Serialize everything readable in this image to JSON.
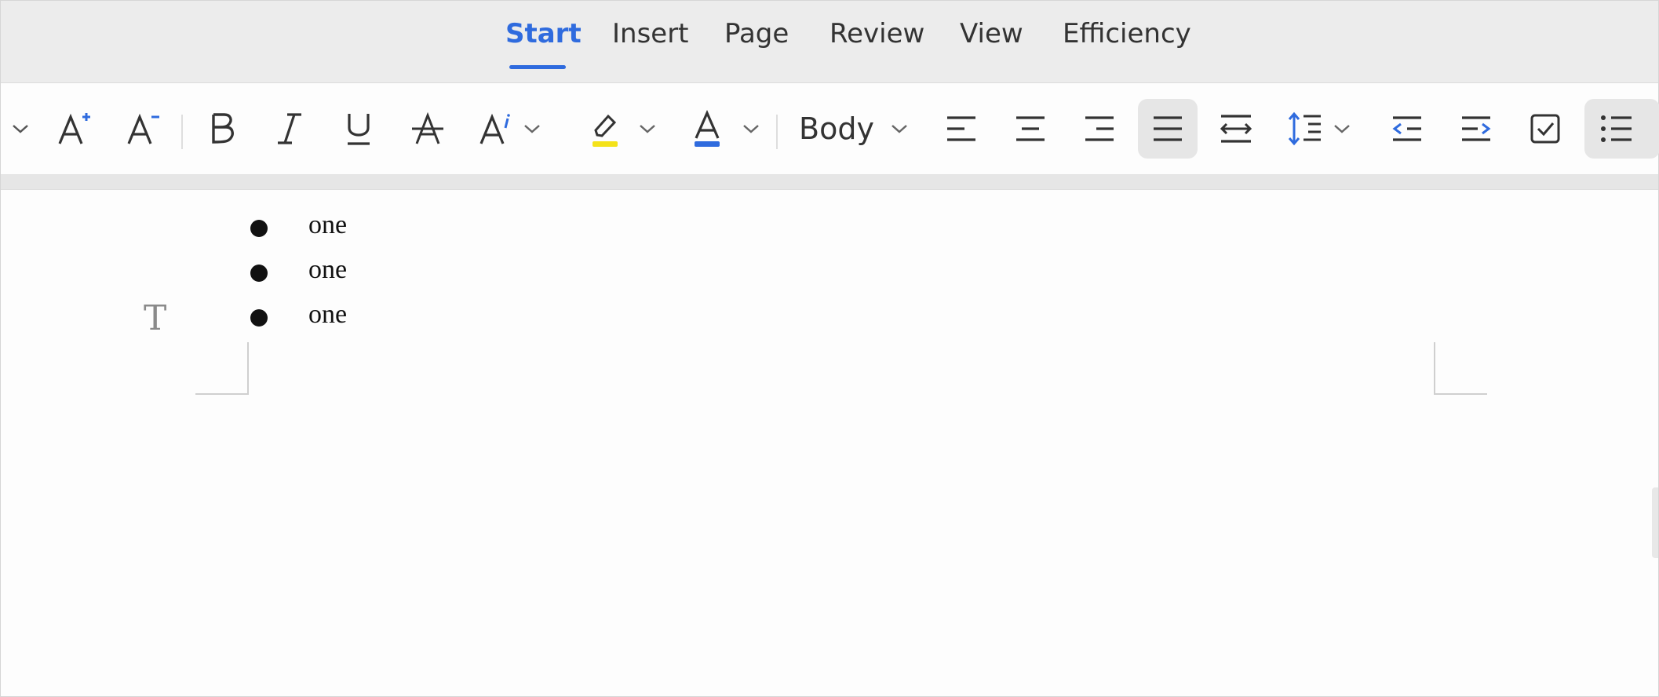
{
  "tabs": [
    {
      "label": "Start",
      "active": true
    },
    {
      "label": "Insert"
    },
    {
      "label": "Page"
    },
    {
      "label": "Review"
    },
    {
      "label": "View"
    },
    {
      "label": "Efficiency"
    }
  ],
  "toolbar": {
    "paragraph_style": "Body",
    "icons": [
      "chevron-down-icon",
      "increase-font-size-icon",
      "decrease-font-size-icon",
      "bold-icon",
      "italic-icon",
      "underline-icon",
      "strikethrough-icon",
      "text-effect-icon",
      "highlight-icon",
      "font-color-icon",
      "align-left-icon",
      "align-center-icon",
      "align-right-icon",
      "justify-icon",
      "distributed-icon",
      "line-spacing-icon",
      "decrease-indent-icon",
      "increase-indent-icon",
      "checkbox-icon",
      "bullet-list-icon"
    ],
    "active": [
      "justify-icon",
      "bullet-list-icon"
    ],
    "highlight_color": "#f4e21a",
    "font_color": "#2f6bde"
  },
  "document": {
    "list_items": [
      "one",
      "one",
      "one"
    ],
    "cursor_marker": "T"
  }
}
